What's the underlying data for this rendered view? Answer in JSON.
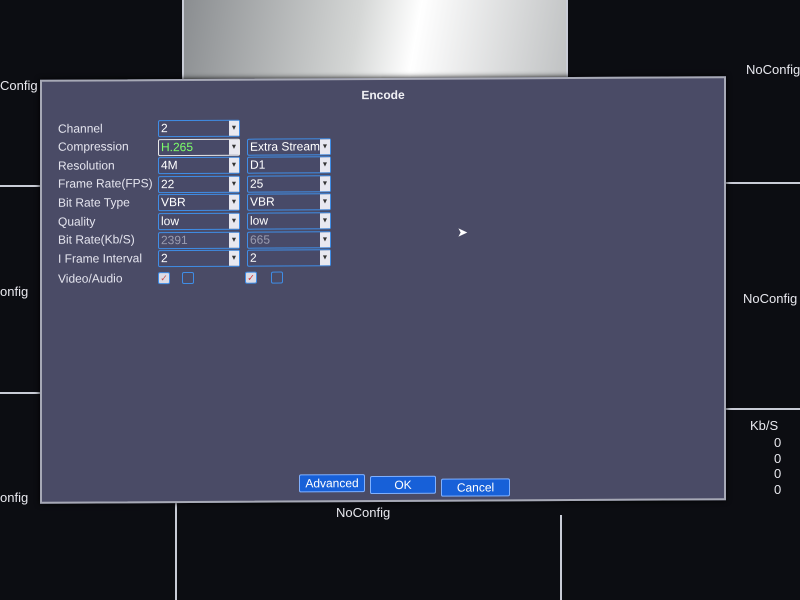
{
  "background": {
    "labels": [
      "Config",
      "NoConfig",
      "onfig",
      "NoConfig",
      "onfig",
      "NoConfig"
    ],
    "kbs_header": "Kb/S",
    "kbs_values": [
      "0",
      "0",
      "0",
      "0"
    ]
  },
  "dialog": {
    "title": "Encode",
    "fields": [
      {
        "label": "Channel",
        "main": "2",
        "extra": null
      },
      {
        "label": "Compression",
        "main": "H.265",
        "extra": "Extra Stream"
      },
      {
        "label": "Resolution",
        "main": "4M",
        "extra": "D1"
      },
      {
        "label": "Frame Rate(FPS)",
        "main": "22",
        "extra": "25"
      },
      {
        "label": "Bit Rate Type",
        "main": "VBR",
        "extra": "VBR"
      },
      {
        "label": "Quality",
        "main": "low",
        "extra": "low"
      },
      {
        "label": "Bit Rate(Kb/S)",
        "main": "2391",
        "extra": "665"
      },
      {
        "label": "I Frame Interval",
        "main": "2",
        "extra": "2"
      }
    ],
    "video_audio": {
      "label": "Video/Audio",
      "main_video": true,
      "main_audio": false,
      "extra_video": true,
      "extra_audio": false
    },
    "buttons": {
      "advanced": "Advanced",
      "ok": "OK",
      "cancel": "Cancel"
    }
  }
}
